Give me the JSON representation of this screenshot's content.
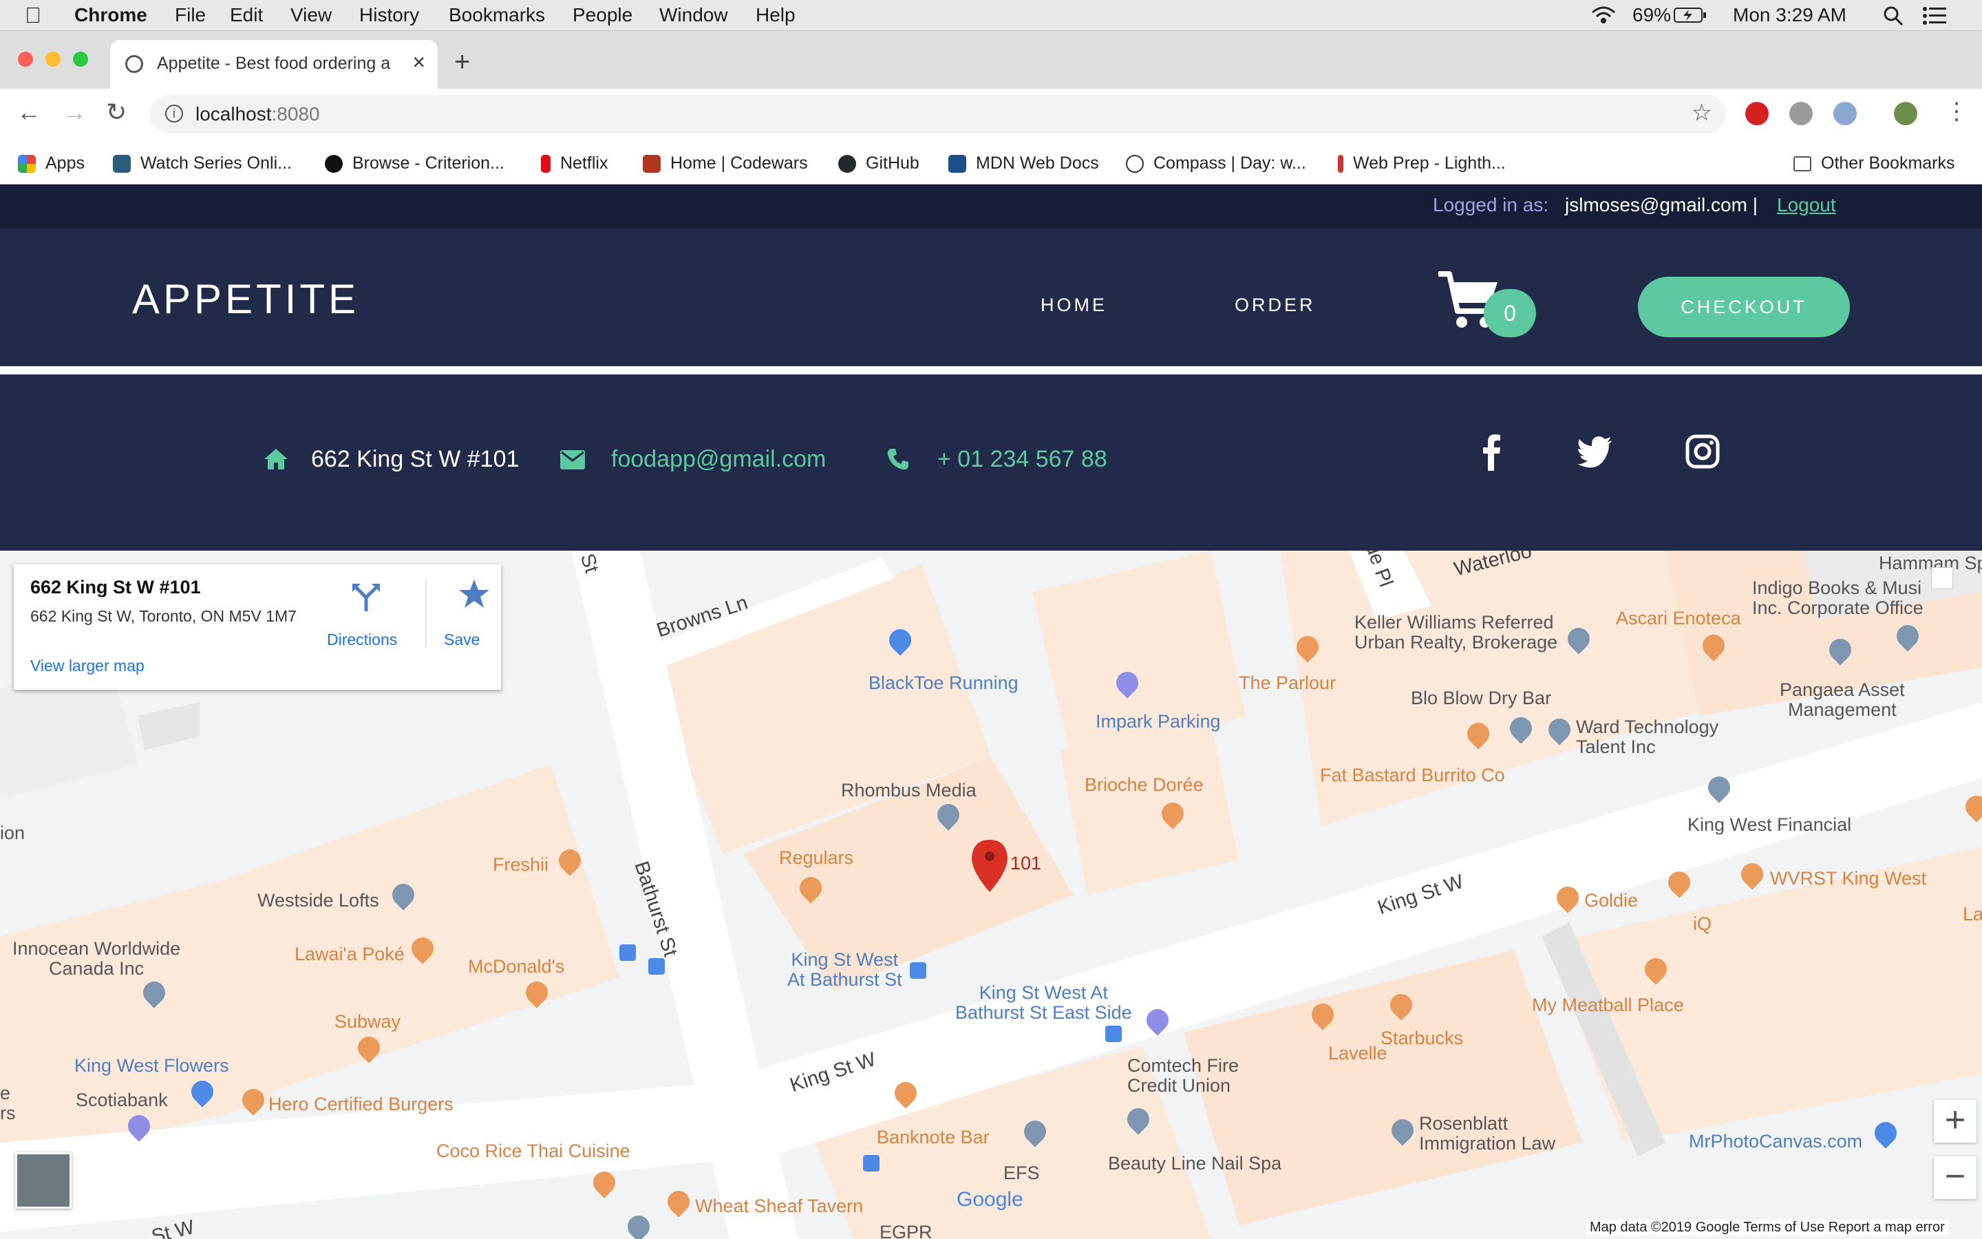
{
  "menubar": {
    "app": "Chrome",
    "items": [
      "File",
      "Edit",
      "View",
      "History",
      "Bookmarks",
      "People",
      "Window",
      "Help"
    ],
    "battery": "69%",
    "clock": "Mon 3:29 AM"
  },
  "browser": {
    "tab_title": "Appetite - Best food ordering a",
    "url_host": "localhost",
    "url_port": ":8080",
    "bookmarks": [
      {
        "label": "Apps",
        "color": "#4285f4"
      },
      {
        "label": "Watch Series Onli...",
        "color": "#2a5d7a"
      },
      {
        "label": "Browse - Criterion...",
        "color": "#111111"
      },
      {
        "label": "Netflix",
        "color": "#e50914"
      },
      {
        "label": "Home | Codewars",
        "color": "#b1361e"
      },
      {
        "label": "GitHub",
        "color": "#24292e"
      },
      {
        "label": "MDN Web Docs",
        "color": "#1b4f8a"
      },
      {
        "label": "Compass | Day: w...",
        "color": "#333333"
      },
      {
        "label": "Web Prep - Lighth...",
        "color": "#cc3333"
      }
    ],
    "other_bookmarks": "Other Bookmarks"
  },
  "site": {
    "login_label": "Logged in as:",
    "user_email": "jslmoses@gmail.com |",
    "logout": "Logout",
    "logo": "APPETITE",
    "nav": {
      "home": "HOME",
      "order": "ORDER"
    },
    "cart_count": "0",
    "checkout": "CHECKOUT",
    "contact": {
      "address": "662 King St W #101",
      "email": "foodapp@gmail.com",
      "phone": "+ 01 234 567 88"
    },
    "colors": {
      "accent": "#5dc9a1",
      "navy": "#222a4a",
      "navy_dark": "#161d37"
    }
  },
  "map": {
    "card": {
      "name": "662 King St W #101",
      "address": "662 King St W, Toronto, ON M5V 1M7",
      "directions": "Directions",
      "save": "Save",
      "larger": "View larger map"
    },
    "marker_label": "101",
    "labels": {
      "blacktoe": "BlackToe Running",
      "impark": "Impark Parking",
      "parlour": "The Parlour",
      "keller": "Keller Williams Referred\nUrban Realty, Brokerage",
      "ascari": "Ascari Enoteca",
      "indigo": "Indigo Books & Musi\nInc. Corporate Office",
      "blowdry": "Blo Blow Dry Bar",
      "ward": "Ward Technology\nTalent Inc",
      "pangaea": "Pangaea Asset\nManagement",
      "fatbastard": "Fat Bastard Burrito Co",
      "brioche": "Brioche Dorée",
      "rhombus": "Rhombus Media",
      "regulars": "Regulars",
      "freshii": "Freshii",
      "westside": "Westside Lofts",
      "innocean": "Innocean Worldwide\nCanada Inc",
      "lawai": "Lawai'a Poké",
      "mcdonalds": "McDonald's",
      "subway": "Subway",
      "kwflowers": "King West Flowers",
      "scotiabank": "Scotiabank",
      "hero": "Hero Certified Burgers",
      "coco": "Coco Rice Thai Cuisine",
      "wheatsheaf": "Wheat Sheaf Tavern",
      "banknote": "Banknote Bar",
      "efs": "EFS",
      "egpr": "EGPR",
      "kwbathurst": "King St West\nAt Bathurst St",
      "kwbathurst_east": "King St West At\nBathurst St East Side",
      "comtech": "Comtech Fire\nCredit Union",
      "beauty": "Beauty Line Nail Spa",
      "lavelle": "Lavelle",
      "starbucks": "Starbucks",
      "meatball": "My Meatball Place",
      "goldie": "Goldie",
      "iq": "iQ",
      "wvrst": "WVRST King West",
      "kwfinancial": "King West Financial",
      "rosenblatt": "Rosenblatt\nImmigration Law",
      "mrphoto": "MrPhotoCanvas.com",
      "hammam": "Hammam Sp",
      "ion": "ion",
      "la": "La",
      "e_left": "e\nrs"
    },
    "streets": {
      "browns": "Browns Ln",
      "bathurst": "Bathurst St",
      "kingw1": "King St W",
      "kingw2": "King St W",
      "waterloo": "Waterloo",
      "st_top": "St",
      "stw_bottom": "St W",
      "pl": "de Pl"
    },
    "google": "Google",
    "attribution": "Map data ©2019 Google    Terms of Use    Report a map error"
  }
}
